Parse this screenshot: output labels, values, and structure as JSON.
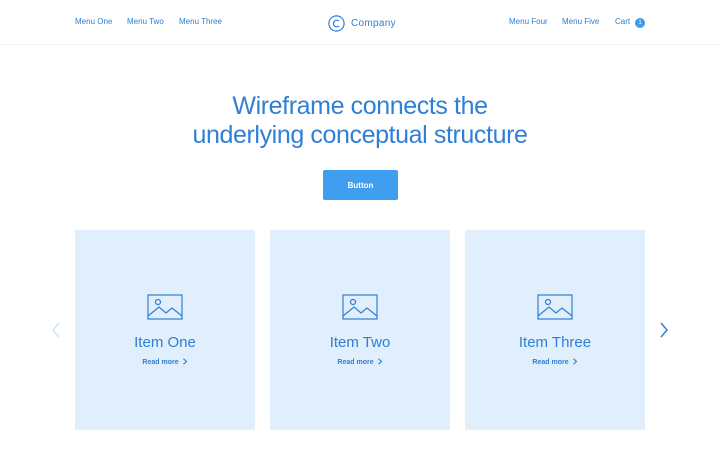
{
  "header": {
    "left_menu": [
      {
        "label": "Menu One"
      },
      {
        "label": "Menu Two"
      },
      {
        "label": "Menu Three"
      }
    ],
    "brand": {
      "name": "Company",
      "icon": "copyright-c-logo-icon"
    },
    "right_menu": [
      {
        "label": "Menu Four"
      },
      {
        "label": "Menu Five"
      },
      {
        "label": "Cart"
      }
    ],
    "cart_count": "1"
  },
  "hero": {
    "headline_line1": "Wireframe connects the",
    "headline_line2": "underlying conceptual structure",
    "button_label": "Button"
  },
  "carousel": {
    "prev_icon": "chevron-left-icon",
    "next_icon": "chevron-right-icon",
    "items": [
      {
        "title": "Item One",
        "link": "Read more",
        "icon": "image-placeholder-icon"
      },
      {
        "title": "Item Two",
        "link": "Read more",
        "icon": "image-placeholder-icon"
      },
      {
        "title": "Item Three",
        "link": "Read more",
        "icon": "image-placeholder-icon"
      }
    ]
  },
  "colors": {
    "accent": "#2e7fd6",
    "button": "#3f9ef0",
    "card_background": "#e1eefb",
    "disabled_arrow": "#cfe3f6"
  }
}
